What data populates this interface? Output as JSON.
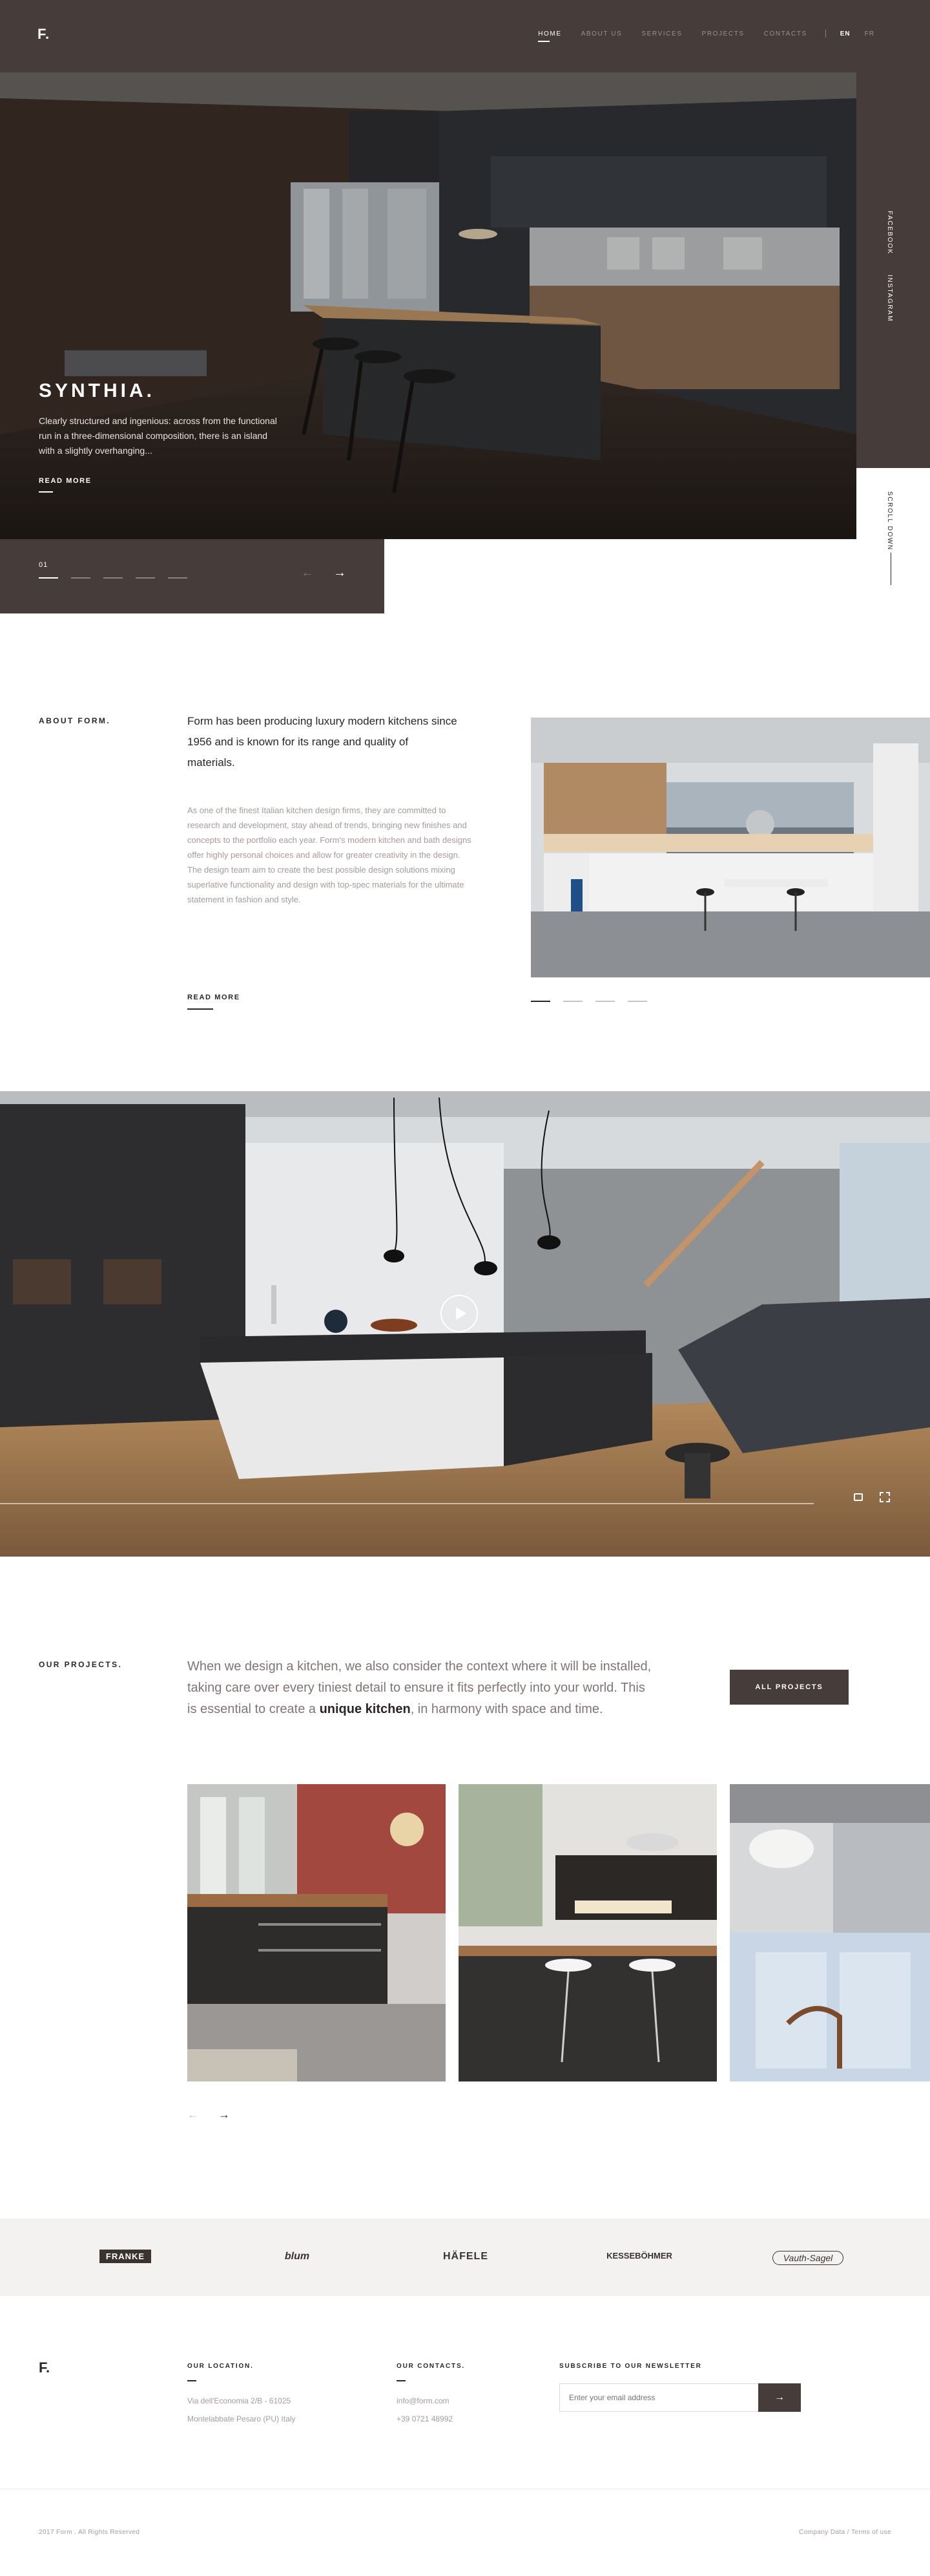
{
  "header": {
    "logo": "F.",
    "nav": [
      "HOME",
      "ABOUT US",
      "SERVICES",
      "PROJECTS",
      "CONTACTS"
    ],
    "languages": [
      "EN",
      "FR"
    ],
    "active_language": "EN"
  },
  "hero": {
    "title": "SYNTHIA.",
    "description": "Clearly structured and ingenious: across from the functional run in a three-dimensional composition, there is an island with a slightly overhanging...",
    "read_more": "READ MORE",
    "slide_number": "01",
    "social": [
      "FACEBOOK",
      "INSTAGRAM"
    ],
    "scroll_label": "SCROLL DOWN"
  },
  "about": {
    "label": "ABOUT FORM.",
    "lead": "Form has been producing luxury modern kitchens since 1956 and is known for its range and quality of materials.",
    "body": "As one of the finest Italian kitchen design firms, they are committed to research and development, stay ahead of trends, bringing new finishes and concepts to the portfolio each year. Form's modern kitchen and bath designs offer highly personal choices and allow for greater creativity in the design. The design team aim to create the best possible design solutions mixing superlative functionality and design with top-spec materials for the ultimate statement in fashion and style.",
    "read_more": "READ MORE"
  },
  "projects": {
    "label": "OUR PROJECTS.",
    "text_before": "When we design a kitchen, we also consider the context where it will be installed, taking care over every tiniest detail to ensure it fits perfectly into your world. This is essential to create a ",
    "text_bold": "unique kitchen",
    "text_after": ", in harmony with space and time.",
    "button": "ALL PROJECTS"
  },
  "brands": [
    "FRANKE",
    "blum",
    "HÄFELE",
    "KESSEBÖHMER",
    "Vauth-Sagel"
  ],
  "footer": {
    "logo": "F.",
    "location_head": "OUR LOCATION.",
    "location_line1": "Via dell'Economia 2/B - 61025",
    "location_line2": "Montelabbate Pesaro (PU) Italy",
    "contacts_head": "OUR CONTACTS.",
    "email": "info@form.com",
    "phone": "+39 0721 48992",
    "newsletter_head": "SUBSCRIBE TO OUR NEWSLETTER",
    "newsletter_placeholder": "Enter your email address",
    "copyright": "2017 Form . All Rights Reserved",
    "link_privacy": "Company Data",
    "link_terms": "Terms of use"
  },
  "colors": {
    "brand_dark": "#463c39",
    "text": "#2b2624",
    "muted": "#a59c98",
    "light_bg": "#f3f2f1"
  },
  "icons": [
    "play-icon",
    "arrow-left-icon",
    "arrow-right-icon",
    "fullscreen-icon",
    "volume-icon"
  ]
}
